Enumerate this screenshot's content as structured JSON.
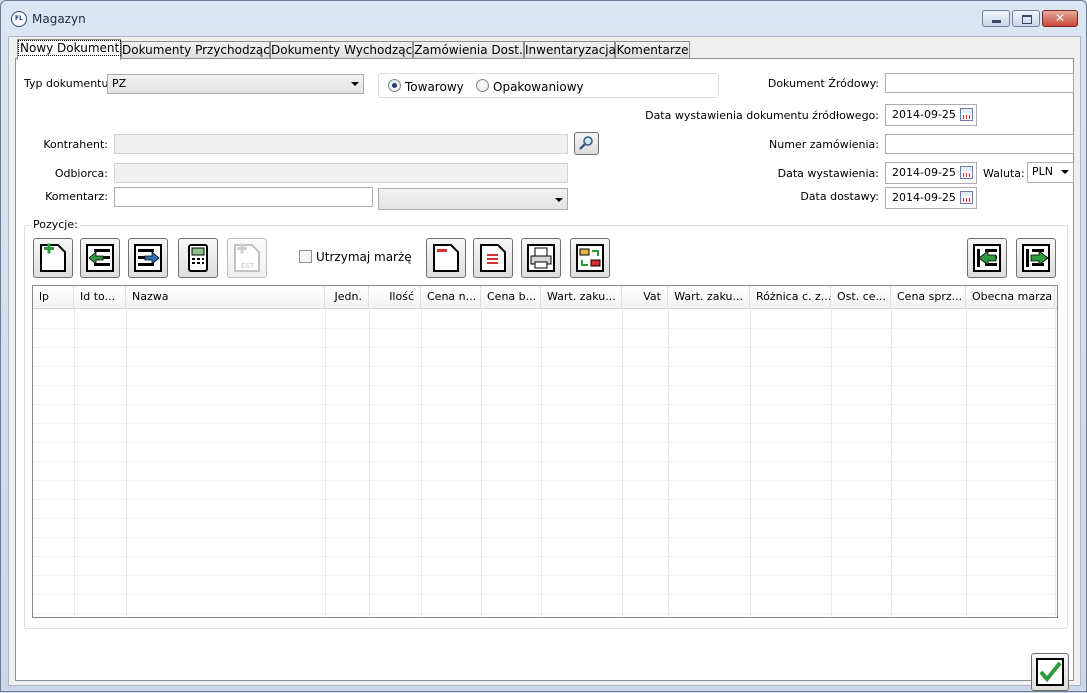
{
  "window": {
    "title": "Magazyn",
    "icon_text": "FL",
    "close_label": "✕"
  },
  "tabs": [
    {
      "label": "Nowy Dokument",
      "active": true
    },
    {
      "label": "Dokumenty Przychodzące"
    },
    {
      "label": "Dokumenty Wychodzące"
    },
    {
      "label": "Zamówienia Dost."
    },
    {
      "label": "Inwentaryzacja"
    },
    {
      "label": "Komentarze"
    }
  ],
  "form": {
    "typ_label": "Typ dokumentu:",
    "typ_value": "PZ",
    "radio_towarowy": "Towarowy",
    "radio_opakowaniowy": "Opakowaniowy",
    "radio_selected": "Towarowy",
    "kontrahent_label": "Kontrahent:",
    "kontrahent_value": "",
    "odbiorca_label": "Odbiorca:",
    "odbiorca_value": "",
    "komentarz_label": "Komentarz:",
    "komentarz_value": "",
    "komentarz_combo_value": "",
    "dok_zrodlowy_label": "Dokument Źródowy:",
    "dok_zrodlowy_value": "",
    "data_wyst_zrodl_label": "Data wystawienia dokumentu źródłowego:",
    "data_wyst_zrodl_value": "2014-09-25",
    "numer_zam_label": "Numer zamówienia:",
    "numer_zam_value": "",
    "data_wyst_label": "Data wystawienia:",
    "data_wyst_value": "2014-09-25",
    "waluta_label": "Waluta:",
    "waluta_value": "PLN",
    "data_dost_label": "Data dostawy:",
    "data_dost_value": "2014-09-25"
  },
  "pozycje": {
    "label": "Pozycje:",
    "utrzymaj_label": "Utrzymaj marżę",
    "utrzymaj_checked": false,
    "columns": [
      "lp",
      "Id to...",
      "Nazwa",
      "Jedn.",
      "Ilość",
      "Cena n...",
      "Cena b...",
      "Wart. zaku...",
      "Vat",
      "Wart. zaku...",
      "Różnica c. z...",
      "Ost. ce...",
      "Cena sprz...",
      "Obecna marza"
    ],
    "rows": []
  },
  "colors": {
    "accent_green": "#2e9a3c",
    "accent_blue": "#2f6fb5",
    "accent_red": "#d83030"
  }
}
